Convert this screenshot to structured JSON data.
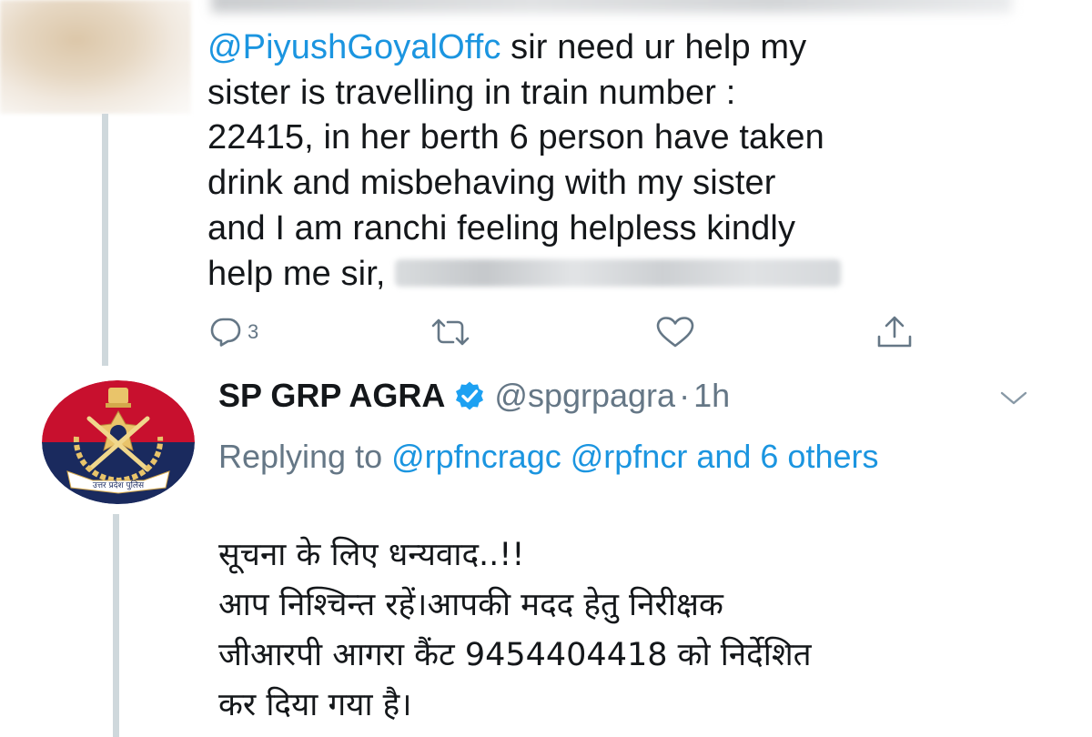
{
  "tweet1": {
    "mention": "@PiyushGoyalOffc",
    "text_line1": " sir need ur help my",
    "text_line2": "sister is travelling in train number :",
    "text_line3": "22415, in her berth 6 person have taken",
    "text_line4": "drink and misbehaving with my sister",
    "text_line5": "and I am ranchi feeling helpless kindly",
    "text_line6": "help me sir,",
    "reply_count": "3"
  },
  "tweet2": {
    "display_name": "SP GRP AGRA",
    "handle": "@spgrpagra",
    "separator": "·",
    "time": "1h",
    "replying_prefix": "Replying to ",
    "replying_mention1": "@rpfncragc",
    "replying_mention2": "@rpfncr",
    "replying_others": "and 6 others",
    "text_line1": "सूचना के लिए धन्यवाद..!!",
    "text_line2": "आप निश्चिन्त रहें।आपकी मदद हेतु निरीक्षक",
    "text_line3": "जीआरपी आगरा कैंट 9454404418 को निर्देशित",
    "text_line4": "कर दिया गया है।",
    "avatar_emblem_text": "उत्तर प्रदेश पुलिस"
  },
  "icons": {
    "reply": "reply-icon",
    "retweet": "retweet-icon",
    "like": "heart-icon",
    "share": "share-icon",
    "verified": "verified-badge-icon",
    "menu": "chevron-down-icon"
  },
  "colors": {
    "link": "#1b95e0",
    "secondary_text": "#657786",
    "primary_text": "#14171a",
    "thread_line": "#cfd8dc",
    "avatar_red": "#c8102e",
    "avatar_navy": "#1a2a5e"
  }
}
